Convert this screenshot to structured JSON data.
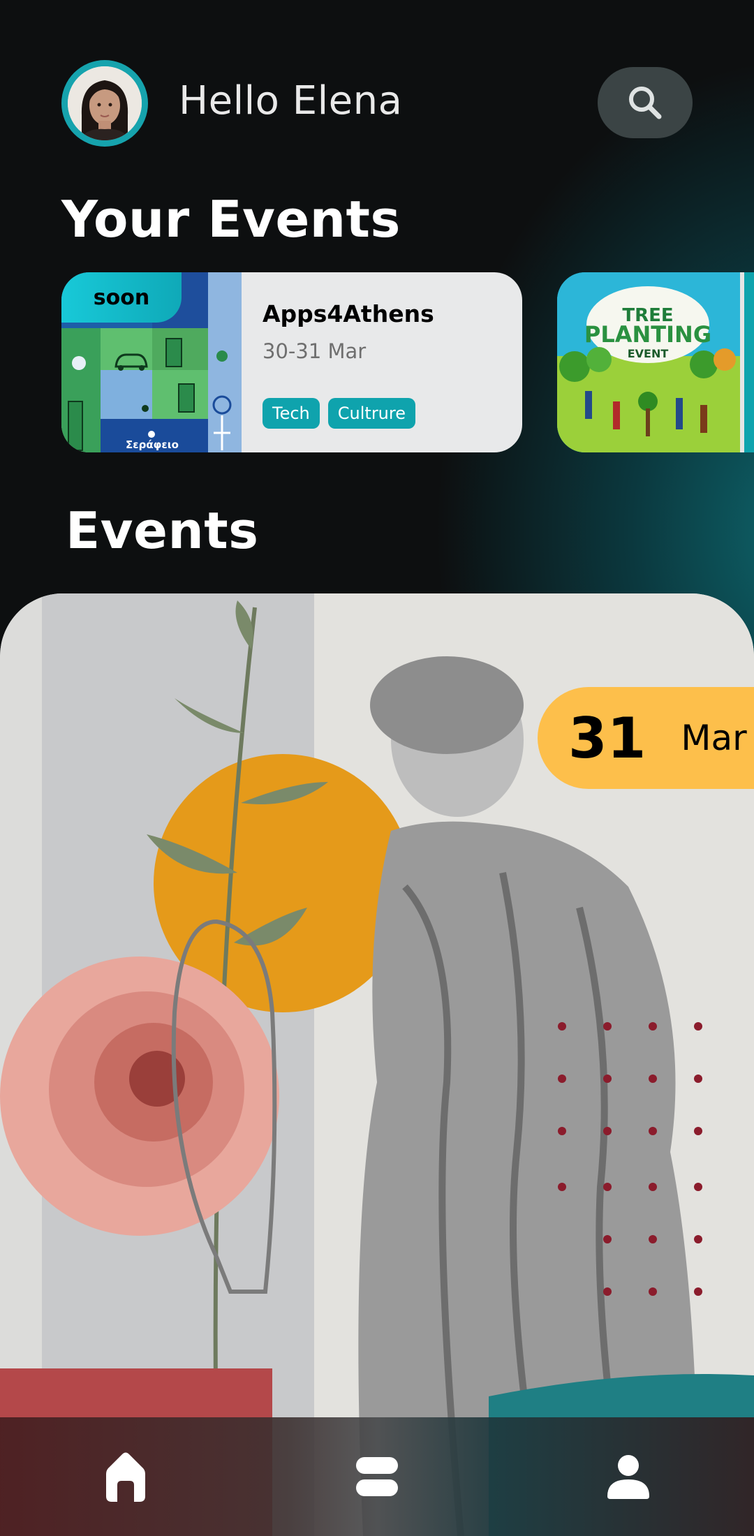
{
  "header": {
    "greeting": "Hello Elena",
    "avatar_icon": "user-avatar",
    "search_icon": "search-icon"
  },
  "your_events": {
    "title": "Your Events",
    "cards": [
      {
        "badge": "soon",
        "title": "Apps4Athens",
        "date": "30-31 Mar",
        "tags": [
          "Tech",
          "Cultrure"
        ],
        "thumb_text": "Σεράφειο"
      },
      {
        "thumb_heading_1": "TREE",
        "thumb_heading_2": "PLANTING",
        "thumb_heading_3": "EVENT"
      }
    ]
  },
  "events": {
    "title": "Events",
    "featured": {
      "day": "31",
      "month": "Mar"
    }
  },
  "nav": {
    "items": [
      "home-icon",
      "list-icon",
      "profile-icon"
    ]
  },
  "colors": {
    "accent": "#0fa3ad",
    "date_pill": "#fdbf4b",
    "background": "#0d0f10"
  }
}
